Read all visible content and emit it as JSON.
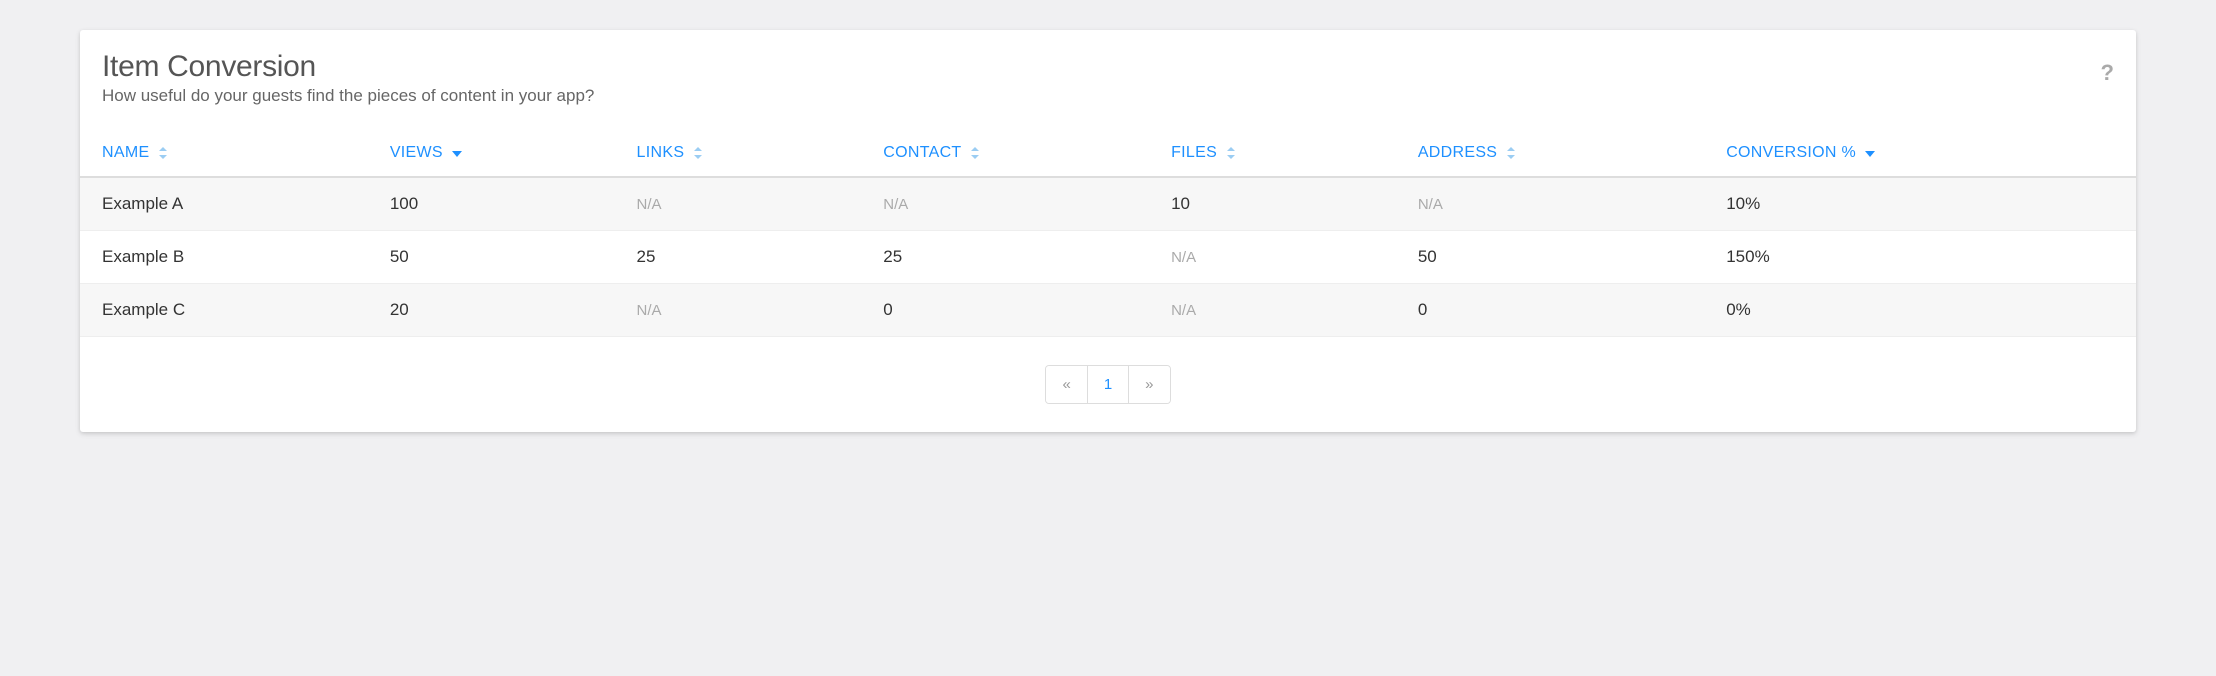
{
  "header": {
    "title": "Item Conversion",
    "subtitle": "How useful do your guests find the pieces of content in your app?"
  },
  "columns": {
    "name": "NAME",
    "views": "VIEWS",
    "links": "LINKS",
    "contact": "CONTACT",
    "files": "FILES",
    "address": "ADDRESS",
    "conversion": "CONVERSION %"
  },
  "rows": [
    {
      "name": "Example A",
      "views": "100",
      "links": "N/A",
      "contact": "N/A",
      "files": "10",
      "address": "N/A",
      "conversion": "10%"
    },
    {
      "name": "Example B",
      "views": "50",
      "links": "25",
      "contact": "25",
      "files": "N/A",
      "address": "50",
      "conversion": "150%"
    },
    {
      "name": "Example C",
      "views": "20",
      "links": "N/A",
      "contact": "0",
      "files": "N/A",
      "address": "0",
      "conversion": "0%"
    }
  ],
  "pagination": {
    "prev": "«",
    "current": "1",
    "next": "»"
  },
  "help": "?"
}
